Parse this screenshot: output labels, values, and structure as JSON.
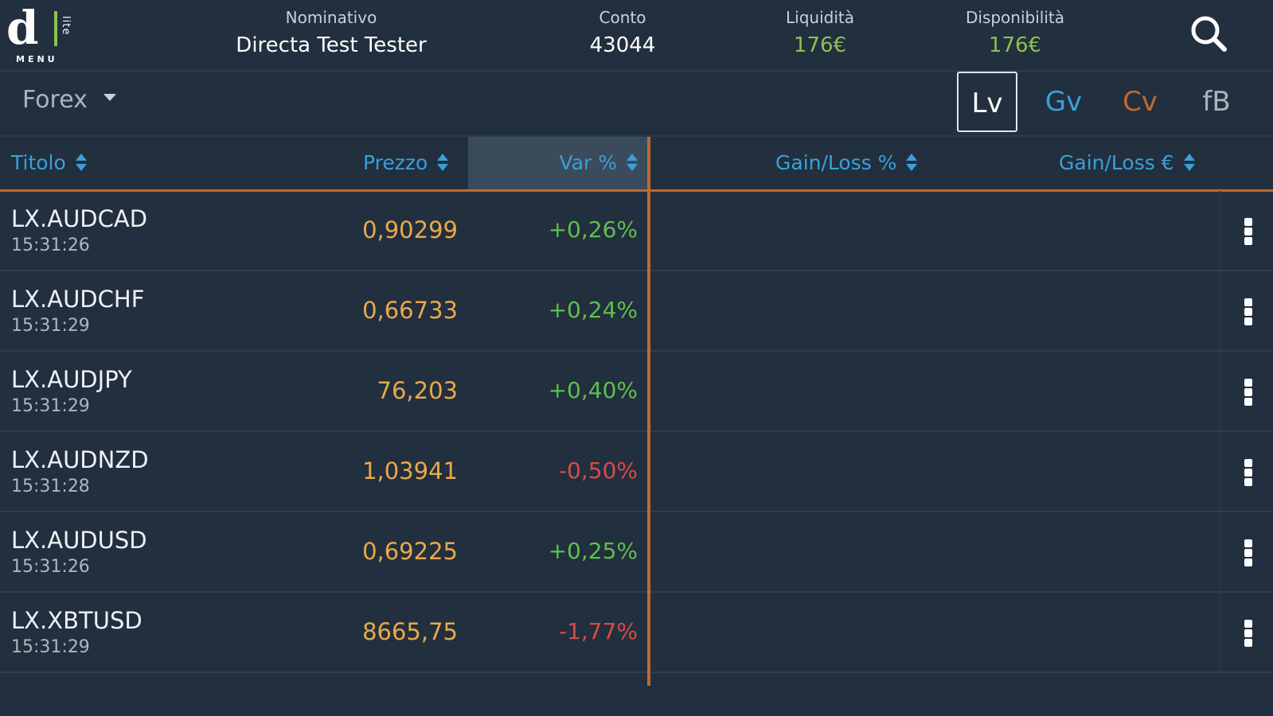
{
  "logo": {
    "lite": "lite",
    "menu": "MENU"
  },
  "header": {
    "nominativo": {
      "label": "Nominativo",
      "value": "Directa Test Tester"
    },
    "conto": {
      "label": "Conto",
      "value": "43044"
    },
    "liquidita": {
      "label": "Liquidità",
      "value": "176€"
    },
    "disponibilita": {
      "label": "Disponibilità",
      "value": "176€"
    },
    "search_icon": "search-icon"
  },
  "toolbar": {
    "market": "Forex",
    "views": [
      {
        "label": "Lv",
        "color": "#ffffff",
        "active": true
      },
      {
        "label": "Gv",
        "color": "#3aa0d8",
        "active": false
      },
      {
        "label": "Cv",
        "color": "#c0692e",
        "active": false
      },
      {
        "label": "fB",
        "color": "#aab4be",
        "active": false
      }
    ]
  },
  "table": {
    "columns": {
      "titolo": "Titolo",
      "prezzo": "Prezzo",
      "var": "Var %",
      "gain_pct": "Gain/Loss %",
      "gain_eur": "Gain/Loss €"
    },
    "rows": [
      {
        "symbol": "LX.AUDCAD",
        "time": "15:31:26",
        "price": "0,90299",
        "var": "+0,26%"
      },
      {
        "symbol": "LX.AUDCHF",
        "time": "15:31:29",
        "price": "0,66733",
        "var": "+0,24%"
      },
      {
        "symbol": "LX.AUDJPY",
        "time": "15:31:29",
        "price": "76,203",
        "var": "+0,40%"
      },
      {
        "symbol": "LX.AUDNZD",
        "time": "15:31:28",
        "price": "1,03941",
        "var": "-0,50%"
      },
      {
        "symbol": "LX.AUDUSD",
        "time": "15:31:26",
        "price": "0,69225",
        "var": "+0,25%"
      },
      {
        "symbol": "LX.XBTUSD",
        "time": "15:31:29",
        "price": "8665,75",
        "var": "-1,77%"
      }
    ]
  },
  "colors": {
    "background": "#222f3e",
    "accent_orange": "#c0692e",
    "header_blue": "#3aa0d8",
    "positive": "#5fbf4e",
    "negative": "#d94a4a",
    "price": "#e9a94a"
  }
}
